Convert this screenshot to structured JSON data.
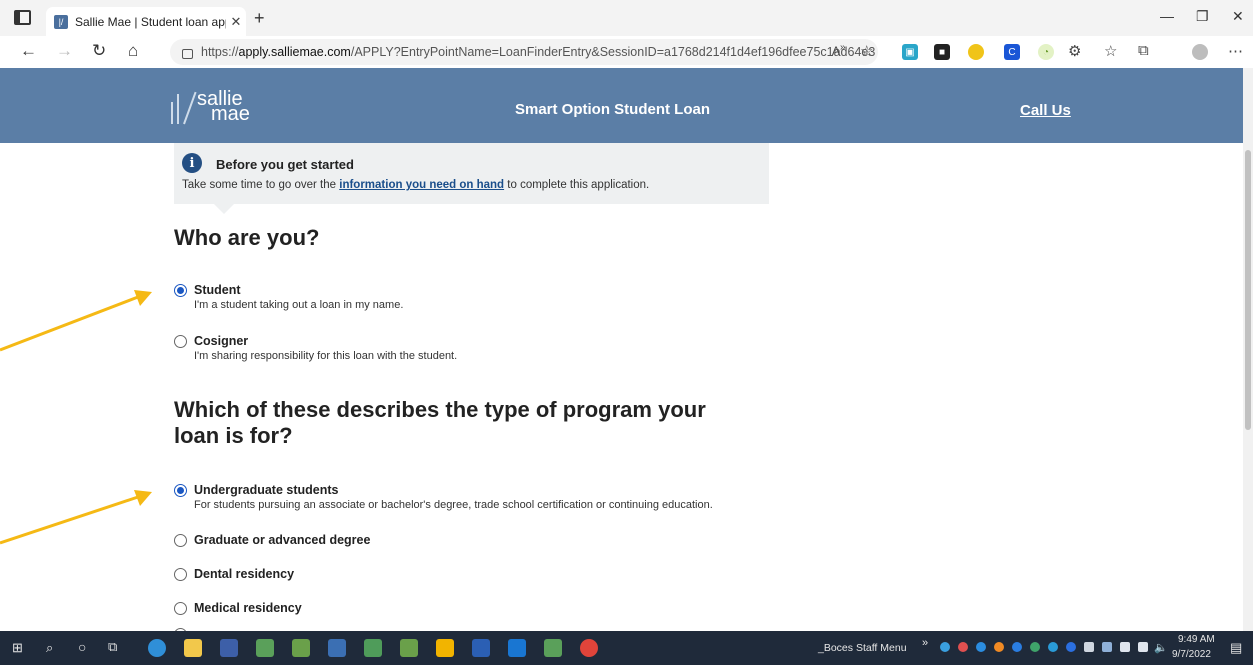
{
  "browser": {
    "tab_title": "Sallie Mae | Student loan applica",
    "url_host": "apply.salliemae.com",
    "url_rest": "/APPLY?EntryPointName=LoanFinderEntry&SessionID=a1768d214f1d4ef196dfee75c1ad64e3",
    "url_scheme": "https://"
  },
  "header": {
    "logo_line1": "sallie",
    "logo_line2": "mae",
    "title": "Smart Option Student Loan",
    "call": "Call Us",
    "bg_color": "#5b7ea6"
  },
  "notice": {
    "title": "Before you get started",
    "text_before": "Take some time to go over the ",
    "link": "information you need on hand",
    "text_after": " to complete this application."
  },
  "q1": {
    "heading": "Who are you?",
    "options": [
      {
        "label": "Student",
        "desc": "I'm a student taking out a loan in my name.",
        "selected": true
      },
      {
        "label": "Cosigner",
        "desc": "I'm sharing responsibility for this loan with the student.",
        "selected": false
      }
    ]
  },
  "q2": {
    "heading_line1": "Which of these describes the type of program your",
    "heading_line2": "loan is for?",
    "options": [
      {
        "label": "Undergraduate students",
        "desc": "For students pursuing an associate or bachelor's degree, trade school certification or continuing education.",
        "selected": true
      },
      {
        "label": "Graduate or advanced degree",
        "selected": false
      },
      {
        "label": "Dental residency",
        "selected": false
      },
      {
        "label": "Medical residency",
        "selected": false
      }
    ]
  },
  "taskbar": {
    "menu_label": "_Boces Staff Menu",
    "time": "9:49 AM",
    "date": "9/7/2022"
  },
  "colors": {
    "arrow": "#f5b915",
    "radio": "#1a57c2",
    "link": "#1a4e8b"
  }
}
